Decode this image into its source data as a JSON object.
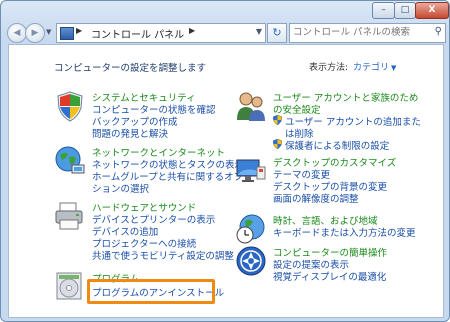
{
  "address": {
    "crumb": "コントロール パネル"
  },
  "search": {
    "placeholder": "コントロール パネルの検索"
  },
  "window_controls": {
    "min": "–",
    "max": "□",
    "close": "X"
  },
  "header": {
    "heading": "コンピューターの設定を調整します",
    "view_by_label": "表示方法:",
    "view_by_value": "カテゴリ"
  },
  "categories": {
    "system": {
      "title": "システムとセキュリティ",
      "links": [
        "コンピューターの状態を確認",
        "バックアップの作成",
        "問題の発見と解決"
      ]
    },
    "network": {
      "title": "ネットワークとインターネット",
      "links": [
        "ネットワークの状態とタスクの表示",
        "ホームグループと共有に関するオプ",
        "ションの選択"
      ]
    },
    "hardware": {
      "title": "ハードウェアとサウンド",
      "links": [
        "デバイスとプリンターの表示",
        "デバイスの追加",
        "プロジェクターへの接続",
        "共通で使うモビリティ設定の調整"
      ]
    },
    "programs": {
      "title": "プログラム",
      "links": [
        "プログラムのアンインストール"
      ]
    },
    "users": {
      "title": "ユーザー アカウントと家族のため",
      "title2": "の安全設定",
      "links": [
        "ユーザー アカウントの追加また",
        "は削除",
        "保護者による制限の設定"
      ]
    },
    "appearance": {
      "title": "デスクトップのカスタマイズ",
      "links": [
        "テーマの変更",
        "デスクトップの背景の変更",
        "画面の解像度の調整"
      ]
    },
    "clock": {
      "title": "時計、言語、および地域",
      "links": [
        "キーボードまたは入力方法の変更"
      ]
    },
    "ease": {
      "title": "コンピューターの簡単操作",
      "links": [
        "設定の提案の表示",
        "視覚ディスプレイの最適化"
      ]
    }
  },
  "highlight_color": "#f08a12"
}
